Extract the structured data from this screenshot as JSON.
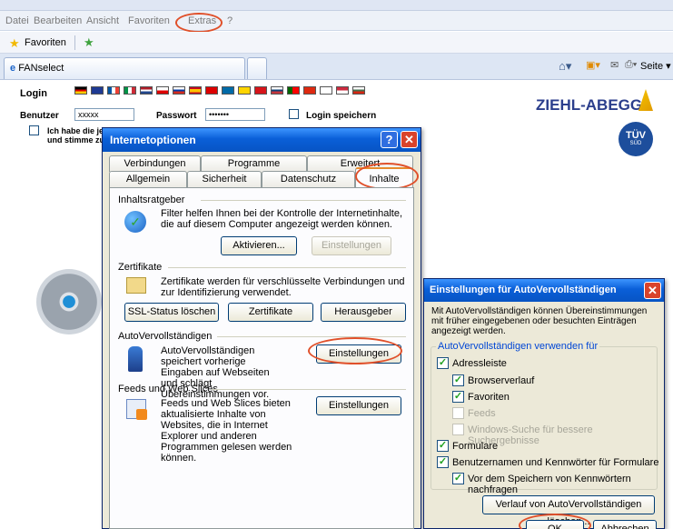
{
  "menu": [
    "Datei",
    "Bearbeiten",
    "Ansicht",
    "Favoriten",
    "Extras",
    "?"
  ],
  "favorites_label": "Favoriten",
  "tab_title": "FANselect",
  "toolbar_right": "Seite ▾",
  "page": {
    "login_title": "Login",
    "user_label": "Benutzer",
    "user_value": "xxxxx",
    "password_label": "Passwort",
    "password_value": "•••••••",
    "save_login_label": "Login speichern",
    "agree_text_1": "Ich habe die je",
    "agree_text_2": "und stimme zu",
    "brand": "ZIEHL-ABEGG",
    "tuv": "TÜV",
    "tuv_sub": "SÜD"
  },
  "internet_options": {
    "title": "Internetoptionen",
    "help_symbol": "?",
    "close_symbol": "✕",
    "tabs_top": [
      "Verbindungen",
      "Programme",
      "Erweitert"
    ],
    "tabs_bottom": [
      "Allgemein",
      "Sicherheit",
      "Datenschutz",
      "Inhalte"
    ],
    "content_advisor": {
      "header": "Inhaltsratgeber",
      "text": "Filter helfen Ihnen bei der Kontrolle der Internetinhalte, die auf diesem Computer angezeigt werden können.",
      "activate_btn": "Aktivieren...",
      "settings_btn": "Einstellungen"
    },
    "certificates": {
      "header": "Zertifikate",
      "text": "Zertifikate werden für verschlüsselte Verbindungen und zur Identifizierung verwendet.",
      "ssl_btn": "SSL-Status löschen",
      "certs_btn": "Zertifikate",
      "publisher_btn": "Herausgeber"
    },
    "autocomplete": {
      "header": "AutoVervollständigen",
      "text": "AutoVervollständigen speichert vorherige Eingaben auf Webseiten und schlägt Übereinstimmungen vor.",
      "settings_btn": "Einstellungen"
    },
    "feeds": {
      "header": "Feeds und Web Slices",
      "text": "Feeds und Web Slices bieten aktualisierte Inhalte von Websites, die in Internet Explorer und anderen Programmen gelesen werden können.",
      "settings_btn": "Einstellungen"
    }
  },
  "autocomplete_settings": {
    "title": "Einstellungen für AutoVervollständigen",
    "close_symbol": "✕",
    "intro": "Mit AutoVervollständigen können Übereinstimmungen mit früher eingegebenen oder besuchten Einträgen angezeigt werden.",
    "group": "AutoVervollständigen verwenden für",
    "options": [
      {
        "label": "Adressleiste",
        "checked": true,
        "enabled": true
      },
      {
        "label": "Browserverlauf",
        "checked": true,
        "enabled": true
      },
      {
        "label": "Favoriten",
        "checked": true,
        "enabled": true
      },
      {
        "label": "Feeds",
        "checked": false,
        "enabled": false
      },
      {
        "label": "Windows-Suche für bessere Suchergebnisse",
        "checked": false,
        "enabled": false
      },
      {
        "label": "Formulare",
        "checked": true,
        "enabled": true
      },
      {
        "label": "Benutzernamen und Kennwörter für Formulare",
        "checked": true,
        "enabled": true
      },
      {
        "label": "Vor dem Speichern von Kennwörtern nachfragen",
        "checked": true,
        "enabled": true
      }
    ],
    "clear_btn": "Verlauf von AutoVervollständigen löschen...",
    "ok_btn": "OK",
    "cancel_btn": "Abbrechen"
  },
  "colors": {
    "highlight_ring": "#e0502a",
    "titlebar": "#0754c4",
    "brand": "#2b3e8c"
  }
}
